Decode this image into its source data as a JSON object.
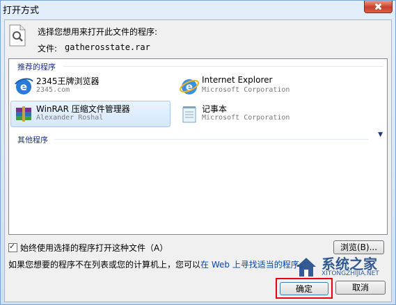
{
  "window": {
    "title": "打开方式"
  },
  "dialog": {
    "prompt": "选择您想用来打开此文件的程序:",
    "file_label": "文件:",
    "file_name": "gatherosstate.rar"
  },
  "groups": {
    "recommended": "推荐的程序",
    "other": "其他程序"
  },
  "programs": [
    {
      "name": "2345王牌浏览器",
      "publisher": "2345.com",
      "icon": "2345-browser-icon"
    },
    {
      "name": "Internet Explorer",
      "publisher": "Microsoft Corporation",
      "icon": "ie-icon"
    },
    {
      "name": "WinRAR 压缩文件管理器",
      "publisher": "Alexander Roshal",
      "icon": "winrar-icon",
      "selected": true
    },
    {
      "name": "记事本",
      "publisher": "Microsoft Corporation",
      "icon": "notepad-icon"
    }
  ],
  "options": {
    "always_use": "始终使用选择的程序打开这种文件（A）",
    "always_use_checked": true
  },
  "buttons": {
    "browse": "浏览(B)...",
    "ok": "确定",
    "cancel": "取消"
  },
  "note": {
    "text": "如果您想要的程序不在列表或您的计算机上，您可以",
    "link": "在 Web 上寻找适当的程序。"
  },
  "watermark": {
    "text": "系统之家",
    "sub": "XITONGZHIJIA.NET"
  }
}
